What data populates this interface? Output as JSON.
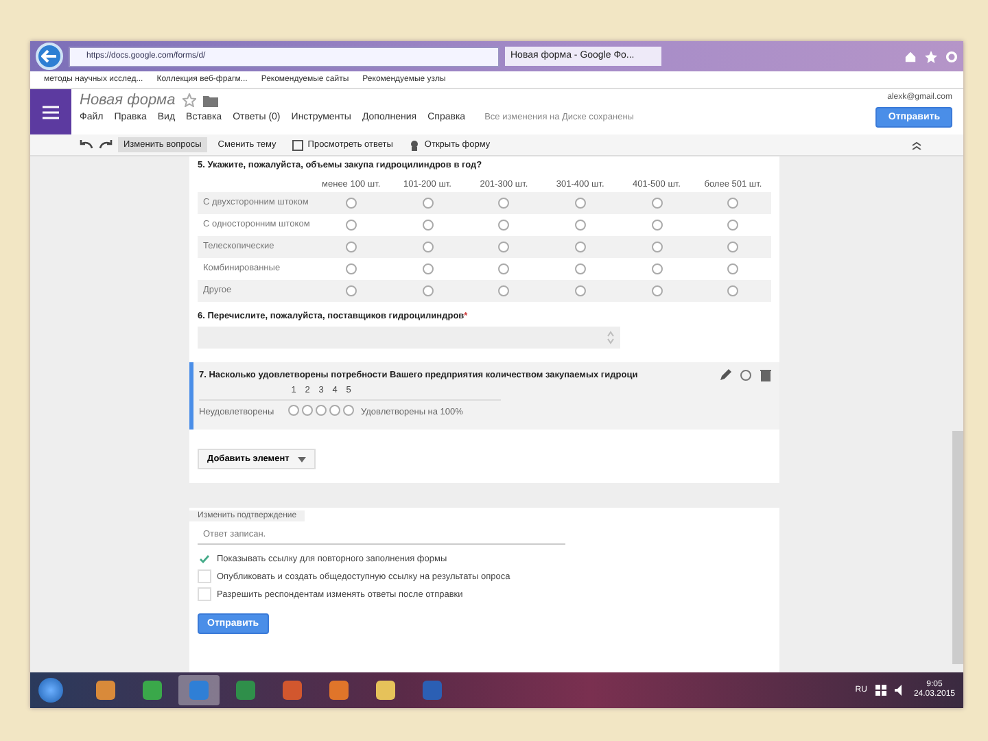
{
  "browser": {
    "url": "https://docs.google.com/forms/d/",
    "tab": "Новая форма - Google Фо...",
    "favorites": [
      "методы научных исслед...",
      "Коллекция веб-фрагм...",
      "Рекомендуемые сайты",
      "Рекомендуемые узлы"
    ]
  },
  "header": {
    "title": "Новая форма",
    "menu": [
      "Файл",
      "Правка",
      "Вид",
      "Вставка",
      "Ответы (0)",
      "Инструменты",
      "Дополнения",
      "Справка"
    ],
    "status": "Все изменения на Диске сохранены",
    "account": "alexk@gmail.com",
    "send": "Отправить"
  },
  "toolbar": [
    {
      "label": "Изменить вопросы",
      "selected": true,
      "kind": "text"
    },
    {
      "label": "Сменить тему",
      "selected": false,
      "kind": "text"
    },
    {
      "label": "Просмотреть ответы",
      "selected": false,
      "kind": "responses"
    },
    {
      "label": "Открыть форму",
      "selected": false,
      "kind": "open"
    }
  ],
  "q5": {
    "title": "5. Укажите, пожалуйста, объемы закупа гидроцилиндров в год?",
    "columns": [
      "менее 100 шт.",
      "101-200 шт.",
      "201-300 шт.",
      "301-400 шт.",
      "401-500 шт.",
      "более 501 шт."
    ],
    "rows": [
      {
        "label": "С двухсторонним штоком",
        "selected": [
          false,
          false,
          false,
          false,
          false,
          false
        ]
      },
      {
        "label": "С односторонним штоком",
        "selected": [
          false,
          false,
          false,
          false,
          false,
          false
        ]
      },
      {
        "label": "Телескопические",
        "selected": [
          false,
          false,
          false,
          false,
          false,
          false
        ]
      },
      {
        "label": "Комбинированные",
        "selected": [
          false,
          false,
          false,
          false,
          false,
          false
        ]
      },
      {
        "label": "Другое",
        "selected": [
          false,
          false,
          false,
          false,
          false,
          false
        ]
      }
    ]
  },
  "q6": {
    "title": "6. Перечислите, пожалуйста, поставщиков гидроцилиндров",
    "required_mark": "*"
  },
  "q7": {
    "title": "7. Насколько удовлетворены потребности Вашего предприятия количеством закупаемых гидроци",
    "scale": [
      {
        "label": "1",
        "selected": false
      },
      {
        "label": "2",
        "selected": false
      },
      {
        "label": "3",
        "selected": false
      },
      {
        "label": "4",
        "selected": false
      },
      {
        "label": "5",
        "selected": false
      }
    ],
    "low": "Неудовлетворены",
    "high": "Удовлетворены на 100%"
  },
  "add_item": "Добавить элемент",
  "confirmation": {
    "tab": "Изменить подтверждение",
    "placeholder": "Ответ записан.",
    "options": [
      {
        "label": "Показывать ссылку для повторного заполнения формы",
        "checked": true
      },
      {
        "label": "Опубликовать и создать общедоступную ссылку на результаты опроса",
        "checked": false
      },
      {
        "label": "Разрешить респондентам изменять ответы после отправки",
        "checked": false
      }
    ],
    "send": "Отправить"
  },
  "taskbar": {
    "apps": [
      {
        "kind": "media",
        "selected": false
      },
      {
        "kind": "chat",
        "selected": false
      },
      {
        "kind": "ie",
        "selected": true
      },
      {
        "kind": "excel",
        "selected": false
      },
      {
        "kind": "ppt",
        "selected": false
      },
      {
        "kind": "firefox",
        "selected": false
      },
      {
        "kind": "folder",
        "selected": false
      },
      {
        "kind": "word",
        "selected": false
      }
    ],
    "lang": "RU",
    "time": "9:05",
    "date": "24.03.2015"
  }
}
